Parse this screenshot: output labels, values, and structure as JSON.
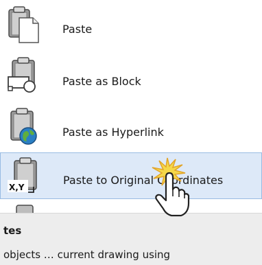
{
  "menu": {
    "items": [
      {
        "label": "Paste",
        "icon": "paste-icon"
      },
      {
        "label": "Paste as Block",
        "icon": "paste-as-block-icon"
      },
      {
        "label": "Paste as Hyperlink",
        "icon": "paste-as-hyperlink-icon"
      },
      {
        "label": "Paste to Original Coordinates",
        "icon": "paste-to-original-coordinates-icon",
        "icon_text": "X,Y",
        "highlighted": true
      }
    ],
    "highlight_color": "#dde9f8",
    "highlight_border": "#98bbe3"
  },
  "tooltip": {
    "title": "tes",
    "description": "objects … current drawing using"
  },
  "cursor": {
    "icon": "hand-pointer-icon",
    "click_effect": "click-burst-icon"
  }
}
